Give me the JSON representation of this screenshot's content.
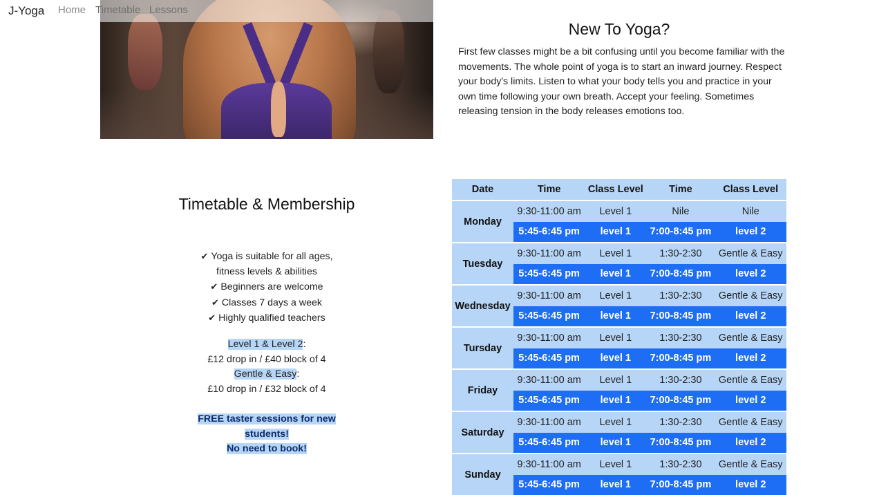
{
  "nav": {
    "brand": "J-Yoga",
    "links": [
      "Home",
      "Timetable",
      "Lessons"
    ]
  },
  "hero": {
    "image": "yoga-back-prayer-pose"
  },
  "new_to_yoga": {
    "title": "New To Yoga?",
    "text": "First few classes might be a bit confusing until you become familiar with the movements. The whole point of yoga is to start an inward journey. Respect your body's limits. Listen to what your body tells you and practice in your own time following your own breath. Accept your feeling. Sometimes releasing tension in the body releases emotions too."
  },
  "membership": {
    "title": "Timetable & Membership",
    "bullets": [
      "Yoga is suitable for all ages,",
      "fitness levels & abilities",
      "Beginners are welcome",
      "Classes 7 days a week",
      "Highly qualified teachers"
    ],
    "prices": [
      {
        "label": "Level 1 & Level 2",
        "price": "£12 drop in / £40 block of 4"
      },
      {
        "label": "Gentle & Easy",
        "price": "£10 drop in / £32 block of 4"
      }
    ],
    "free": [
      "FREE taster sessions for new",
      "students!",
      "No need to book!"
    ]
  },
  "timetable": {
    "headers": [
      "Date",
      "Time",
      "Class Level",
      "Time",
      "Class Level"
    ],
    "days": [
      {
        "day": "Monday",
        "am": [
          "9:30-11:00 am",
          "Level 1",
          "Nile",
          "Nile"
        ],
        "pm": [
          "5:45-6:45 pm",
          "level 1",
          "7:00-8:45 pm",
          "level 2"
        ]
      },
      {
        "day": "Tuesday",
        "am": [
          "9:30-11:00 am",
          "Level 1",
          "1:30-2:30",
          "Gentle & Easy"
        ],
        "pm": [
          "5:45-6:45 pm",
          "level 1",
          "7:00-8:45 pm",
          "level 2"
        ]
      },
      {
        "day": "Wednesday",
        "am": [
          "9:30-11:00 am",
          "Level 1",
          "1:30-2:30",
          "Gentle & Easy"
        ],
        "pm": [
          "5:45-6:45 pm",
          "level 1",
          "7:00-8:45 pm",
          "level 2"
        ]
      },
      {
        "day": "Tursday",
        "am": [
          "9:30-11:00 am",
          "Level 1",
          "1:30-2:30",
          "Gentle & Easy"
        ],
        "pm": [
          "5:45-6:45 pm",
          "level 1",
          "7:00-8:45 pm",
          "level 2"
        ]
      },
      {
        "day": "Friday",
        "am": [
          "9:30-11:00 am",
          "Level 1",
          "1:30-2:30",
          "Gentle & Easy"
        ],
        "pm": [
          "5:45-6:45 pm",
          "level 1",
          "7:00-8:45 pm",
          "level 2"
        ]
      },
      {
        "day": "Saturday",
        "am": [
          "9:30-11:00 am",
          "Level 1",
          "1:30-2:30",
          "Gentle & Easy"
        ],
        "pm": [
          "5:45-6:45 pm",
          "level 1",
          "7:00-8:45 pm",
          "level 2"
        ]
      },
      {
        "day": "Sunday",
        "am": [
          "9:30-11:00 am",
          "Level 1",
          "1:30-2:30",
          "Gentle & Easy"
        ],
        "pm": [
          "5:45-6:45 pm",
          "level 1",
          "7:00-8:45 pm",
          "level 2"
        ]
      }
    ]
  },
  "colors": {
    "accent_light": "#b7d6f7",
    "accent_dark": "#1e6ef5",
    "nav_text": "#8a8a8a"
  }
}
